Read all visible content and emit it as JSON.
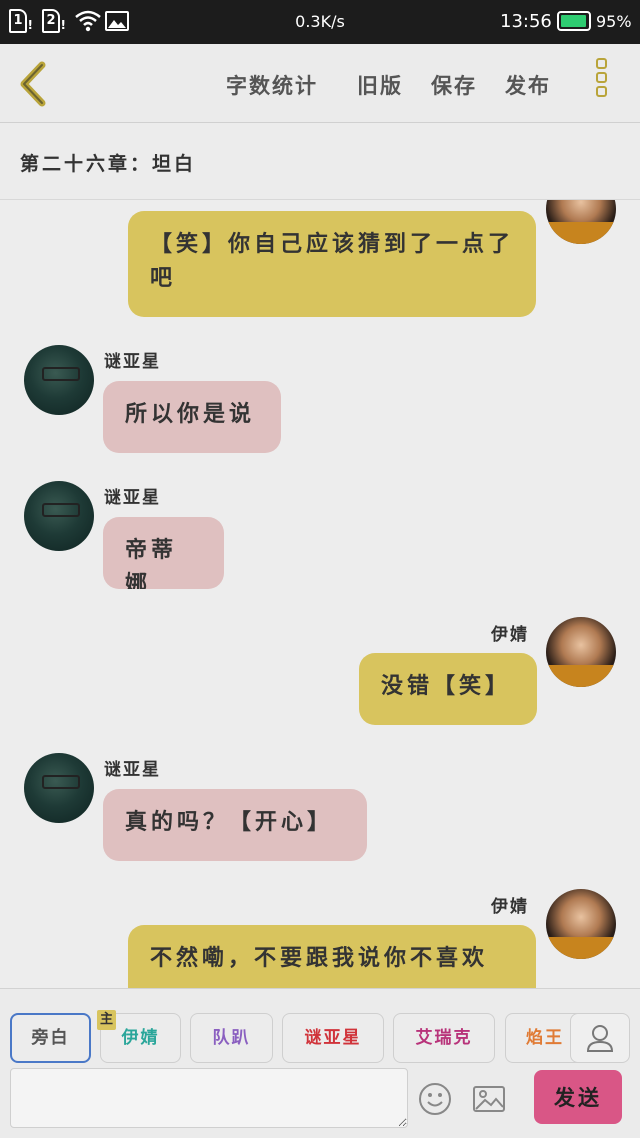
{
  "status_bar": {
    "sim1": "1",
    "sim2": "2",
    "network_speed": "0.3K/s",
    "time": "13:56",
    "battery": "95%",
    "battery_level": 0.95,
    "icons": [
      "sim-icon",
      "sim-icon",
      "wifi-icon",
      "image-notification-icon",
      "battery-icon"
    ]
  },
  "toolbar": {
    "back_icon": "back-arrow-icon",
    "word_count": "字数统计",
    "old_version": "旧版",
    "save": "保存",
    "publish": "发布",
    "more_icon": "more-vertical-icon",
    "accent_color": "#b9a43a"
  },
  "chapter_title": "第二十六章：坦白",
  "messages": [
    {
      "side": "right",
      "speaker": "",
      "text": "【笑】你自己应该猜到了一点了吧",
      "color": "#d8c45e"
    },
    {
      "side": "left",
      "speaker": "谜亚星",
      "text": "所以你是说",
      "color": "#dfc0c0"
    },
    {
      "side": "left",
      "speaker": "谜亚星",
      "text": "帝蒂娜",
      "color": "#dfc0c0"
    },
    {
      "side": "right",
      "speaker": "伊婧",
      "text": "没错【笑】",
      "color": "#d8c45e"
    },
    {
      "side": "left",
      "speaker": "谜亚星",
      "text": "真的吗？【开心】",
      "color": "#dfc0c0"
    },
    {
      "side": "right",
      "speaker": "伊婧",
      "text": "不然嘞，不要跟我说你不喜欢",
      "color": "#d8c45e"
    }
  ],
  "roles": [
    {
      "label": "旁白",
      "color": "#555555"
    },
    {
      "label": "伊婧",
      "color": "#2aa69a",
      "tag": "主"
    },
    {
      "label": "队趴",
      "color": "#8a5fc0"
    },
    {
      "label": "谜亚星",
      "color": "#d0333a"
    },
    {
      "label": "艾瑞克",
      "color": "#b8337a"
    },
    {
      "label": "焰王",
      "color": "#e07b35"
    }
  ],
  "input": {
    "value": "",
    "emoji_icon": "emoji-icon",
    "image_icon": "image-icon",
    "send": "发送",
    "user_icon": "user-icon"
  }
}
